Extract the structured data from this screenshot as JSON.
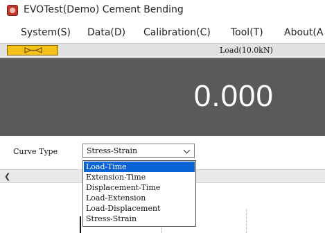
{
  "window": {
    "title": "EVOTest(Demo) Cement Bending"
  },
  "menu": [
    "System(S)",
    "Data(D)",
    "Calibration(C)",
    "Tool(T)",
    "About(A"
  ],
  "status": {
    "load_label": "Load(10.0kN)"
  },
  "readout": {
    "value": "0.000"
  },
  "curve": {
    "label": "Curve Type",
    "selected": "Stress-Strain",
    "options": [
      "Load-Time",
      "Extension-Time",
      "Displacement-Time",
      "Load-Extension",
      "Load-Displacement",
      "Stress-Strain"
    ],
    "highlighted_option": "Load-Time"
  },
  "colors": {
    "readout_bg": "#5a5a5a",
    "highlight": "#0a64d6",
    "link_button": "#f3c21a"
  },
  "icons": {
    "app": "app-icon",
    "link": "link-connect-icon",
    "dropdown": "chevron-down-icon",
    "scroll": "scroll-left-icon"
  }
}
